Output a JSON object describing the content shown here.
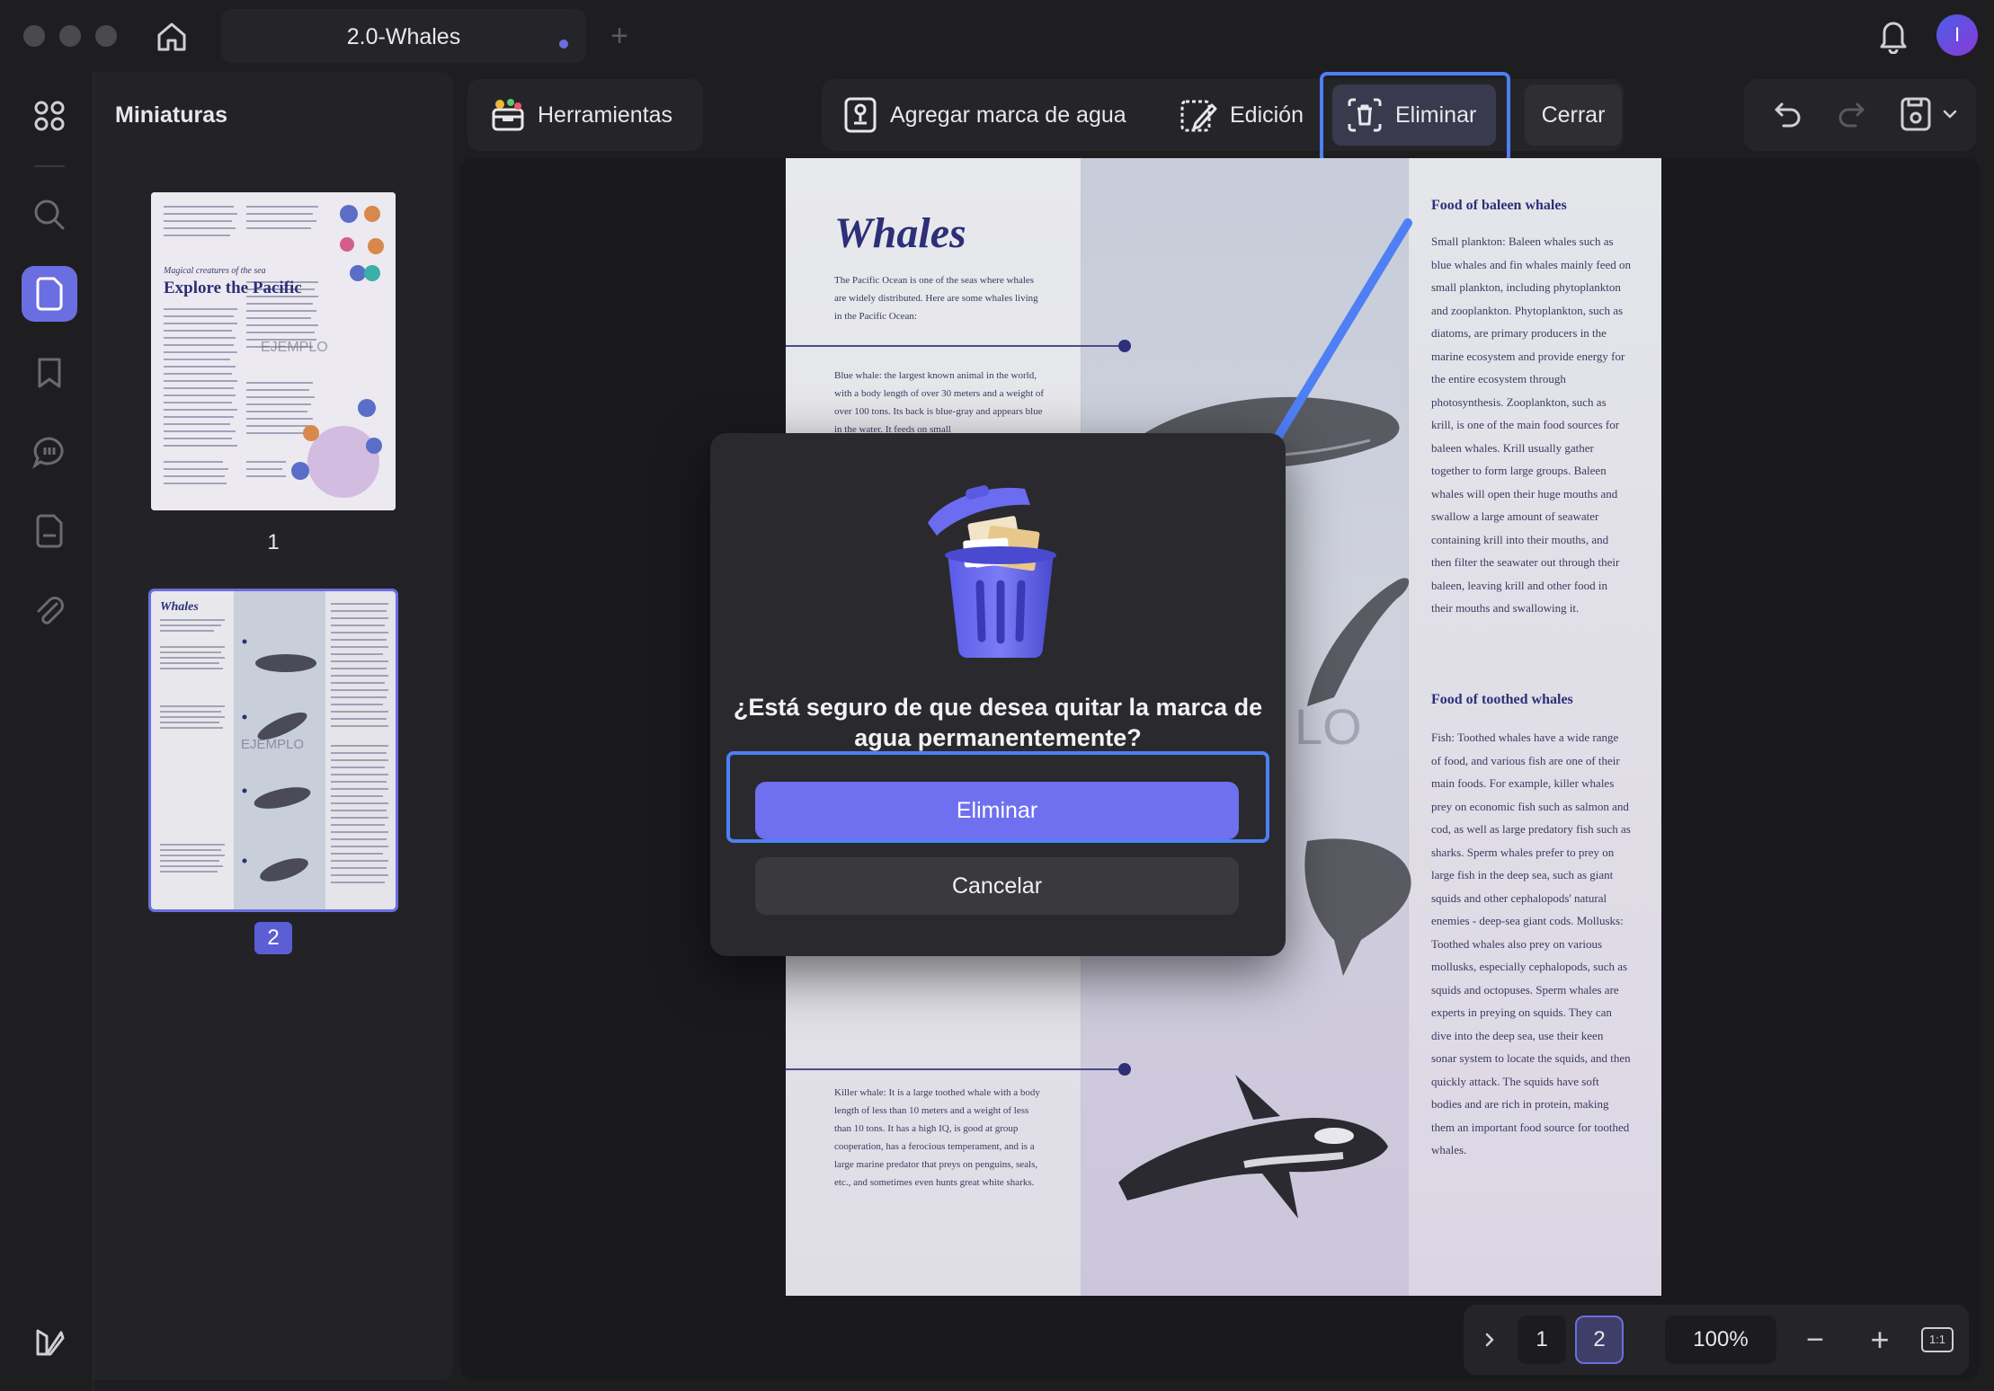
{
  "window": {
    "tab_title": "2.0-Whales",
    "add_tab_symbol": "+",
    "avatar_initial": "I"
  },
  "sidebar": {
    "panel_title": "Miniaturas",
    "thumbnails": [
      {
        "page_label": "1",
        "selected": false
      },
      {
        "page_label": "2",
        "selected": true
      }
    ],
    "rail_icons": [
      "grid-icon",
      "search-icon",
      "page-icon",
      "bookmark-icon",
      "comment-icon",
      "form-icon",
      "attachment-icon",
      "layers-icon"
    ]
  },
  "toolbar": {
    "tools_label": "Herramientas",
    "add_watermark_label": "Agregar marca de agua",
    "edit_label": "Edición",
    "remove_label": "Eliminar",
    "close_label": "Cerrar"
  },
  "document": {
    "title": "Whales",
    "intro": "The Pacific Ocean is one of the seas where whales are widely distributed. Here are some whales living in the Pacific Ocean:",
    "blue_whale": "Blue whale: the largest known animal in the world, with a body length of over 30 meters and a weight of over 100 tons. Its back is blue-gray and appears blue in the water. It feeds on small",
    "killer_whale": "Killer whale: It is a large toothed whale with a body length of less than 10 meters and a weight of less than 10 tons. It has a high IQ, is good at group cooperation, has a ferocious temperament, and is a large marine predator that preys on penguins, seals, etc., and sometimes even hunts great white sharks.",
    "baleen_heading": "Food of baleen whales",
    "baleen_text": "Small plankton: Baleen whales such as blue whales and fin whales mainly feed on small plankton, including phytoplankton and zooplankton. Phytoplankton, such as diatoms, are primary producers in the marine ecosystem and provide energy for the entire ecosystem through photosynthesis. Zooplankton, such as krill, is one of the main food sources for baleen whales. Krill usually gather together to form large groups. Baleen whales will open their huge mouths and swallow a large amount of seawater containing krill into their mouths, and then filter the seawater out through their baleen, leaving krill and other food in their mouths and swallowing it.",
    "toothed_heading": "Food of toothed whales",
    "toothed_text": "Fish: Toothed whales have a wide range of food, and various fish are one of their main foods. For example, killer whales prey on economic fish such as salmon and cod, as well as large predatory fish such as sharks. Sperm whales prefer to prey on large fish in the deep sea, such as giant squids and other cephalopods' natural enemies - deep-sea giant cods. Mollusks: Toothed whales also prey on various mollusks, especially cephalopods, such as squids and octopuses. Sperm whales are experts in preying on squids. They can dive into the deep sea, use their keen sonar system to locate the squids, and then quickly attack. The squids have soft bodies and are rich in protein, making them an important food source for toothed whales.",
    "watermark_fragment": "LO"
  },
  "thumbnail_page1": {
    "subtitle": "Magical creatures of the sea",
    "title": "Explore the Pacific",
    "watermark": "EJEMPLO"
  },
  "thumbnail_page2": {
    "title": "Whales",
    "watermark": "EJEMPLO"
  },
  "dialog": {
    "question": "¿Está seguro de que desea quitar la marca de agua permanentemente?",
    "confirm_label": "Eliminar",
    "cancel_label": "Cancelar"
  },
  "pager": {
    "pages": [
      "1",
      "2"
    ],
    "current_page": "2",
    "zoom": "100%",
    "fit_label": "1:1",
    "zoom_out_symbol": "−",
    "zoom_in_symbol": "+"
  },
  "colors": {
    "accent": "#6b6ee0",
    "highlight_border": "#4e7ff5",
    "primary_button": "#6f70f0"
  }
}
